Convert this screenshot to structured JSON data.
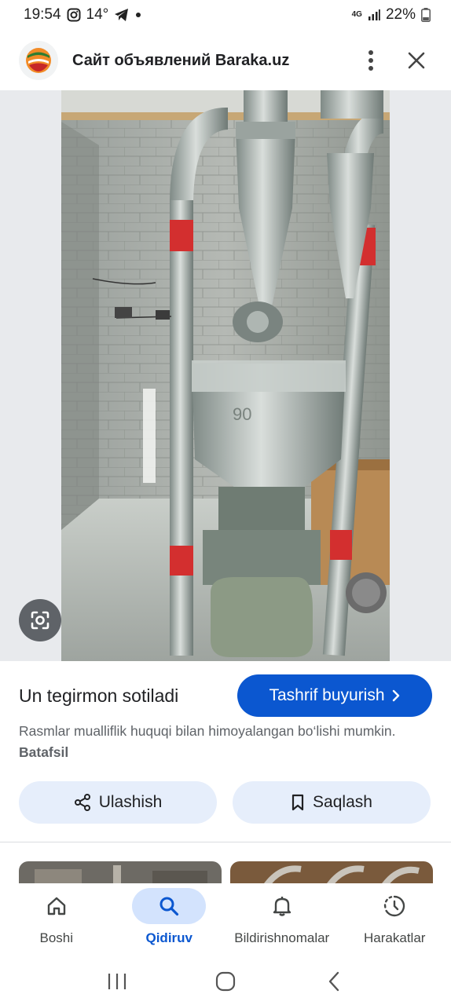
{
  "status_bar": {
    "time": "19:54",
    "temperature": "14°",
    "network": "4G",
    "battery": "22%",
    "icons": [
      "instagram-icon",
      "telegram-icon",
      "dot-icon",
      "signal-icon",
      "battery-icon"
    ]
  },
  "header": {
    "site_title": "Сайт объявлений Baraka.uz",
    "icons": [
      "site-logo",
      "more-vert-icon",
      "close-icon"
    ]
  },
  "image": {
    "lens_icon": "google-lens-icon"
  },
  "result": {
    "title": "Un tegirmon sotiladi",
    "visit_label": "Tashrif buyurish",
    "copyright_text": "Rasmlar mualliflik huquqi bilan himoyalangan bo‘lishi mumkin.",
    "more_link": "Batafsil"
  },
  "actions": {
    "share_label": "Ulashish",
    "save_label": "Saqlash"
  },
  "bottom_nav": {
    "items": [
      {
        "label": "Boshi",
        "icon": "home-icon"
      },
      {
        "label": "Qidiruv",
        "icon": "search-icon"
      },
      {
        "label": "Bildirishnomalar",
        "icon": "bell-icon"
      },
      {
        "label": "Harakatlar",
        "icon": "activity-icon"
      }
    ],
    "active": "Qidiruv"
  },
  "colors": {
    "accent": "#0b57d0",
    "active_nav_bg": "#d3e3fd",
    "action_bg": "#e6eefb"
  }
}
